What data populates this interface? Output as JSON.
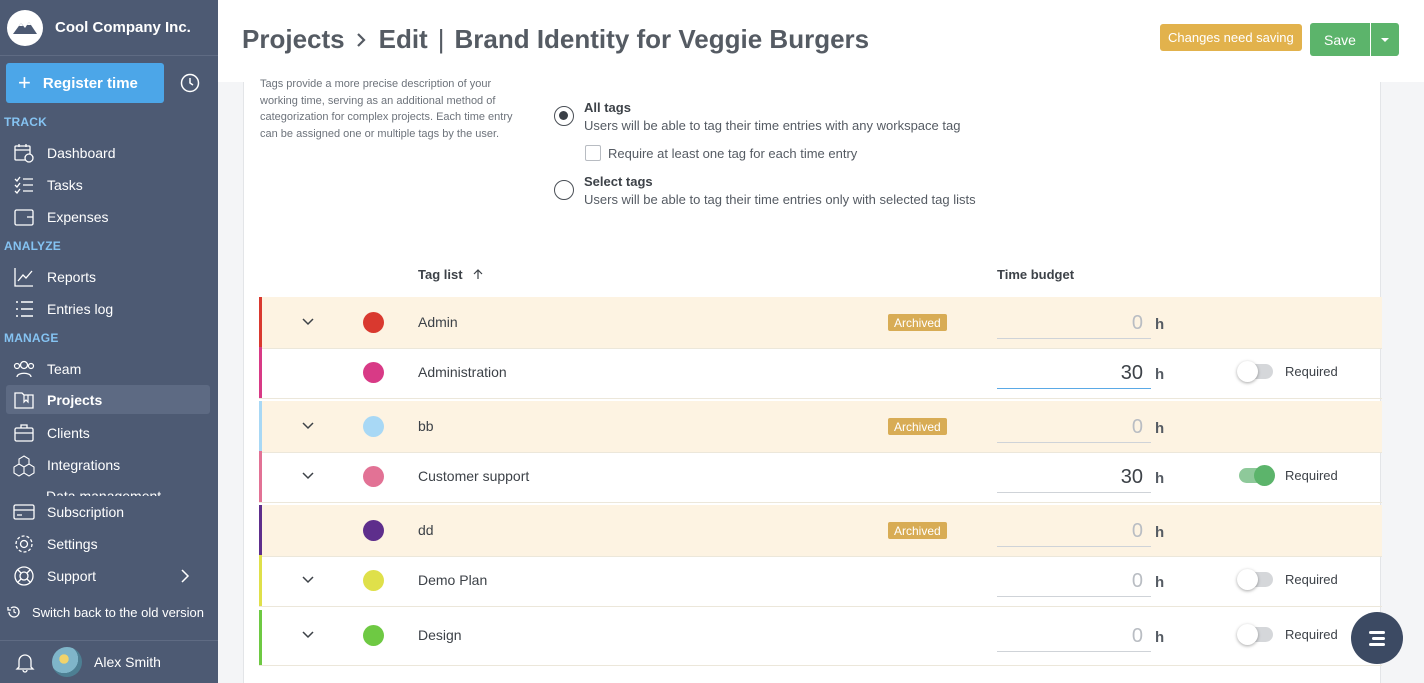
{
  "sidebar": {
    "company": "Cool Company Inc.",
    "register_label": "Register time",
    "sections": {
      "track": "TRACK",
      "analyze": "ANALYZE",
      "manage": "MANAGE"
    },
    "items": {
      "dashboard": "Dashboard",
      "tasks": "Tasks",
      "expenses": "Expenses",
      "reports": "Reports",
      "entries_log": "Entries log",
      "team": "Team",
      "projects": "Projects",
      "clients": "Clients",
      "integrations": "Integrations",
      "data_management": "Data management",
      "subscription": "Subscription",
      "settings": "Settings",
      "support": "Support"
    },
    "switch_old": "Switch back to the old version",
    "user_name": "Alex Smith"
  },
  "header": {
    "crumb_projects": "Projects",
    "crumb_edit": "Edit",
    "separator": "|",
    "project_name": "Brand Identity for Veggie Burgers",
    "changes_badge": "Changes need saving",
    "save_label": "Save"
  },
  "tags": {
    "description": "Tags provide a more precise description of your working time, serving as an additional method of categorization for complex projects. Each time entry can be assigned one or multiple tags by the user.",
    "all_tags_title": "All tags",
    "all_tags_sub": "Users will be able to tag their time entries with any workspace tag",
    "require_label": "Require at least one tag for each time entry",
    "select_tags_title": "Select tags",
    "select_tags_sub": "Users will be able to tag their time entries only with selected tag lists",
    "col_tag_list": "Tag list",
    "col_time_budget": "Time budget",
    "unit": "h",
    "archived_label": "Archived",
    "required_label": "Required",
    "rows": [
      {
        "name": "Admin",
        "color": "#d9392f",
        "archived": true,
        "budget": "0",
        "required": null,
        "expandable": true
      },
      {
        "name": "Administration",
        "color": "#d83a86",
        "archived": false,
        "budget": "30",
        "required": false,
        "expandable": false
      },
      {
        "name": "bb",
        "color": "#a8d8f5",
        "archived": true,
        "budget": "0",
        "required": null,
        "expandable": true
      },
      {
        "name": "Customer support",
        "color": "#e27295",
        "archived": false,
        "budget": "30",
        "required": true,
        "expandable": true
      },
      {
        "name": "dd",
        "color": "#5e2e8c",
        "archived": true,
        "budget": "0",
        "required": null,
        "expandable": false
      },
      {
        "name": "Demo Plan",
        "color": "#dfe04a",
        "archived": false,
        "budget": "0",
        "required": false,
        "expandable": true
      },
      {
        "name": "Design",
        "color": "#6ec943",
        "archived": false,
        "budget": "0",
        "required": false,
        "expandable": true
      }
    ]
  }
}
